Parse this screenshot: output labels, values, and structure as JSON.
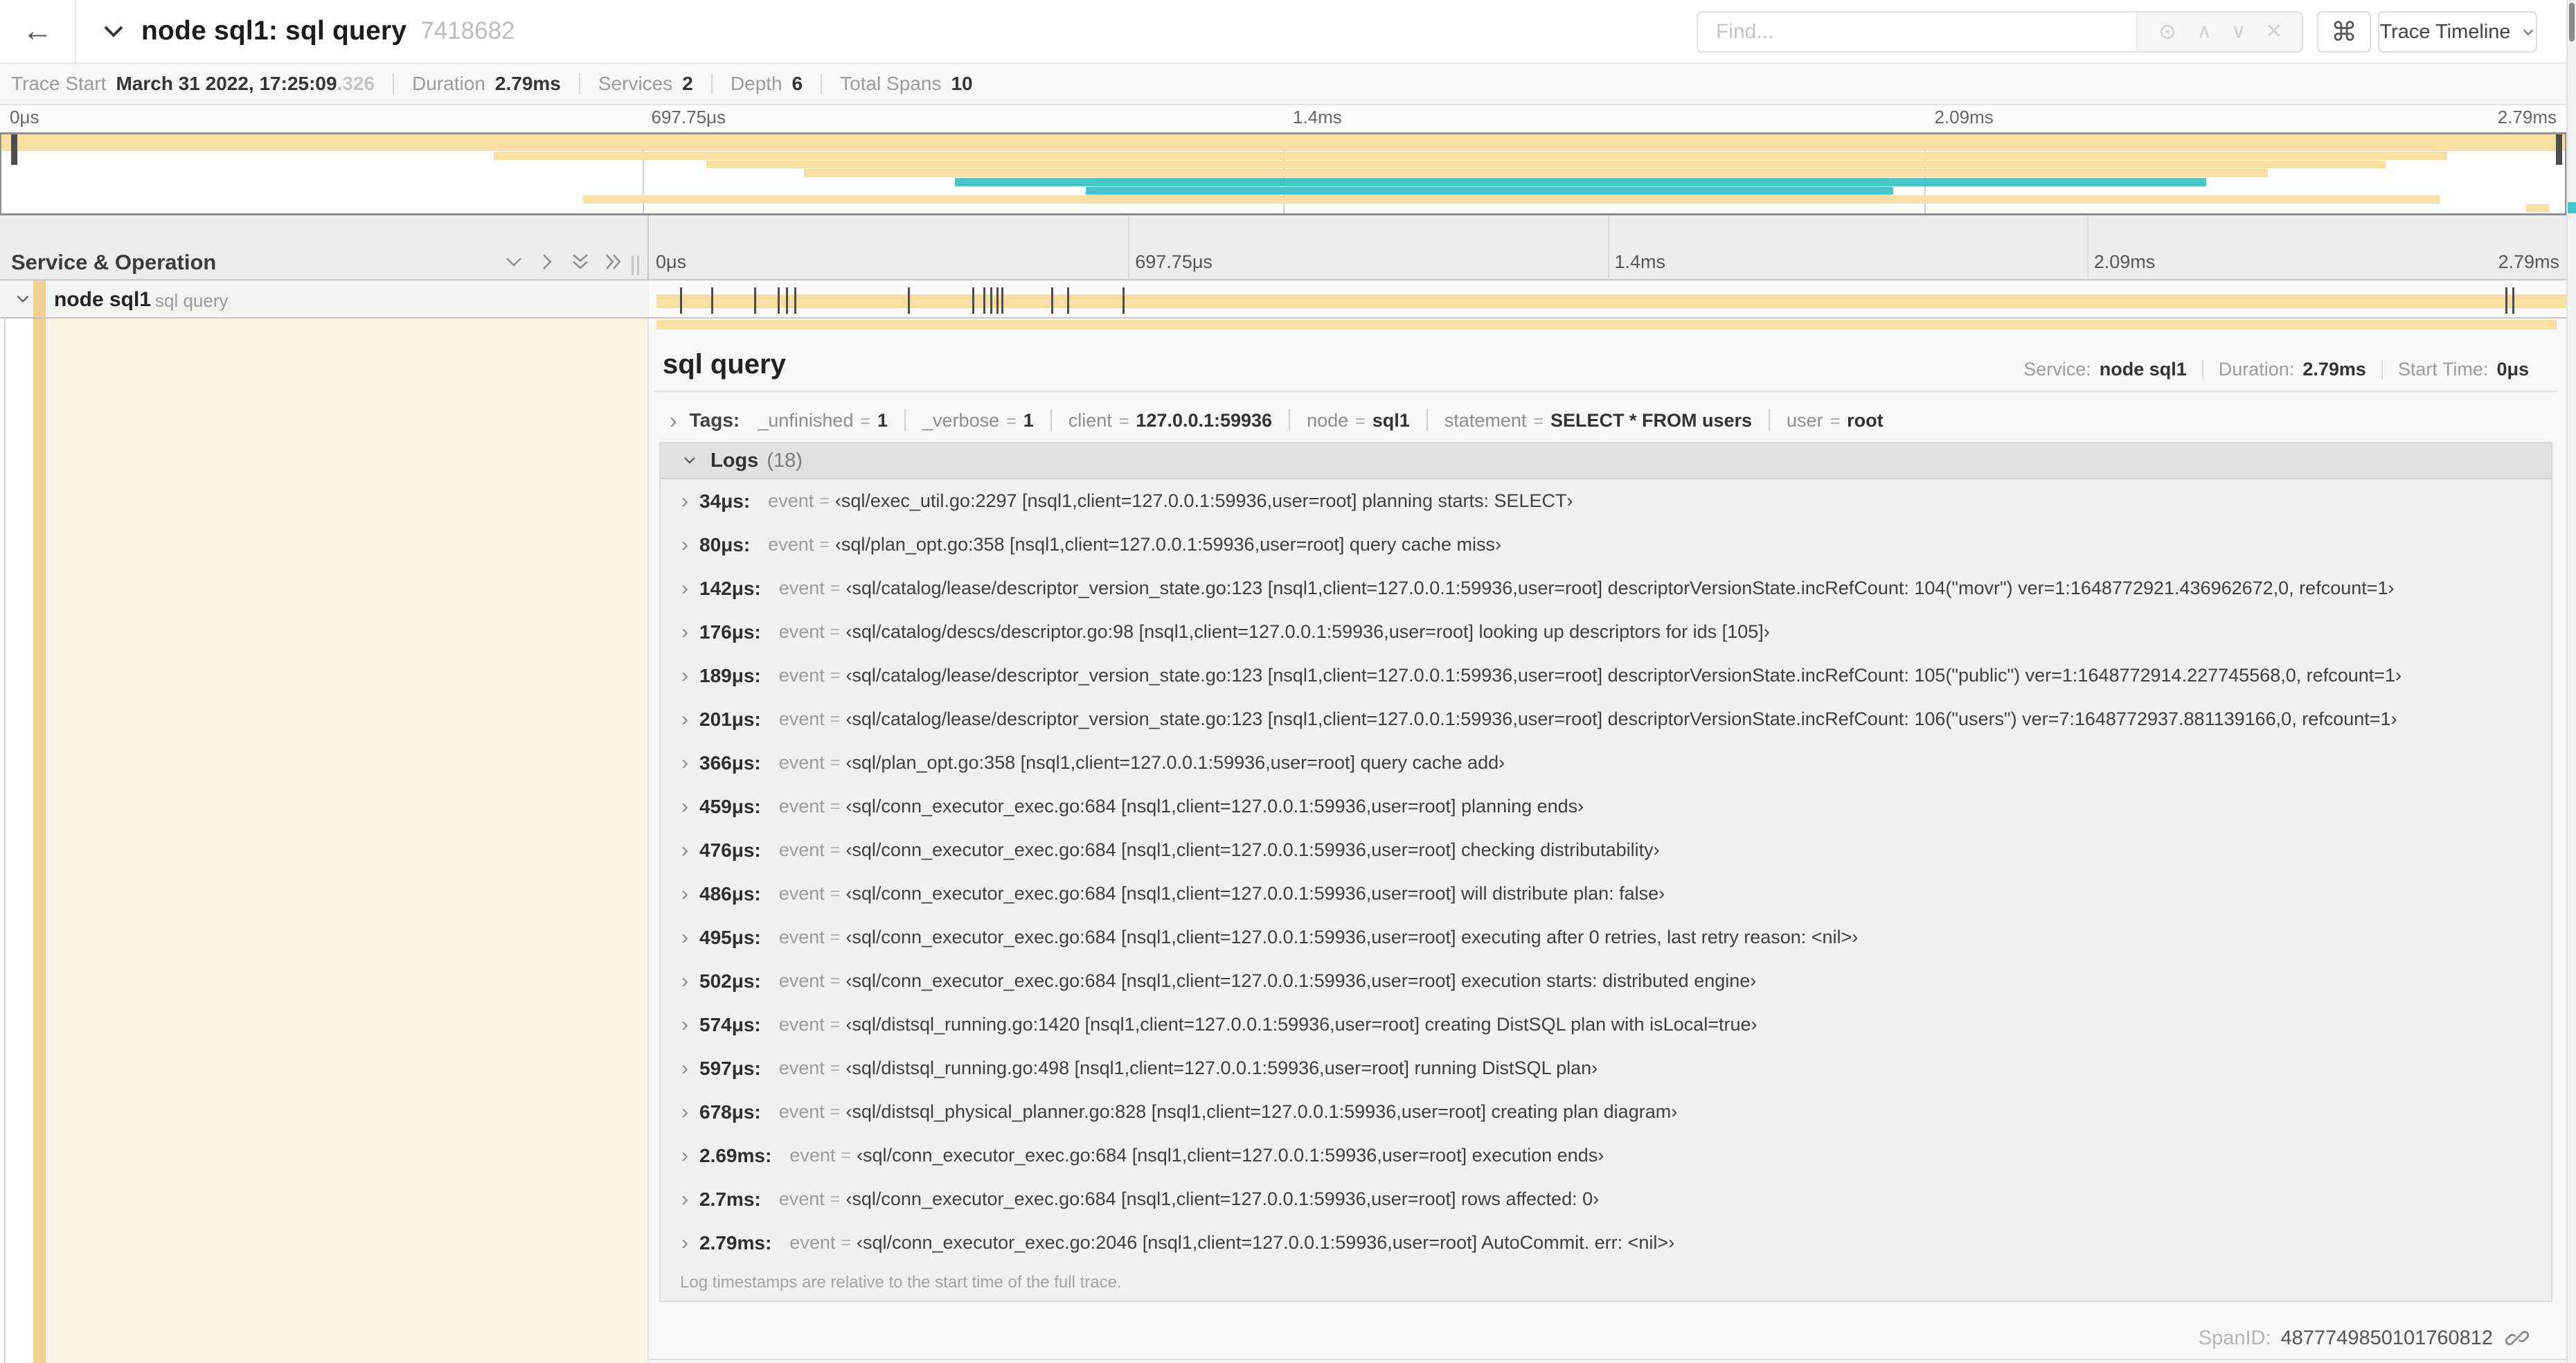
{
  "header": {
    "back_icon": "←",
    "title": "node sql1: sql query",
    "trace_id": "7418682",
    "find_placeholder": "Find...",
    "cmd_symbol": "⌘",
    "view_selector": "Trace Timeline",
    "addon_icons": [
      "crosshair-icon",
      "chevron-up-icon",
      "chevron-down-icon",
      "clear-icon"
    ]
  },
  "trace_meta": {
    "items": [
      {
        "label": "Trace Start",
        "value": "March 31 2022, 17:25:09",
        "suffix": ".326"
      },
      {
        "label": "Duration",
        "value": "2.79ms"
      },
      {
        "label": "Services",
        "value": "2"
      },
      {
        "label": "Depth",
        "value": "6"
      },
      {
        "label": "Total Spans",
        "value": "10"
      }
    ]
  },
  "timeline": {
    "axis_labels": [
      "0μs",
      "697.75μs",
      "1.4ms",
      "2.09ms",
      "2.79ms"
    ],
    "grid_pcts": [
      25,
      50,
      75
    ]
  },
  "minimap": {
    "rows": [
      {
        "left": 0,
        "width": 100,
        "color": "tan",
        "row": 0,
        "h": 2
      },
      {
        "left": 19.2,
        "width": 76.2,
        "color": "tan",
        "row": 2,
        "h": 1
      },
      {
        "left": 27.5,
        "width": 65.5,
        "color": "tan",
        "row": 3,
        "h": 1
      },
      {
        "left": 31.3,
        "width": 57.1,
        "color": "tan",
        "row": 4,
        "h": 1
      },
      {
        "left": 37.2,
        "width": 48.8,
        "color": "teal",
        "row": 5,
        "h": 1
      },
      {
        "left": 42.3,
        "width": 31.5,
        "color": "teal",
        "row": 6,
        "h": 1
      },
      {
        "left": 22.7,
        "width": 72.4,
        "color": "tan",
        "row": 7,
        "h": 1
      },
      {
        "left": 98.5,
        "width": 0.9,
        "color": "tan",
        "row": 8,
        "h": 1
      }
    ]
  },
  "span_list": {
    "header_label": "Service & Operation",
    "row": {
      "service": "node sql1",
      "operation": "sql query"
    },
    "tick_pcts": [
      1.22,
      2.87,
      5.09,
      6.31,
      6.77,
      7.2,
      13.12,
      16.45,
      17.06,
      17.42,
      17.74,
      18.0,
      20.57,
      21.4,
      24.3,
      96.42,
      96.77
    ]
  },
  "detail": {
    "title": "sql query",
    "meta": [
      {
        "label": "Service:",
        "value": "node sql1"
      },
      {
        "label": "Duration:",
        "value": "2.79ms"
      },
      {
        "label": "Start Time:",
        "value": "0μs"
      }
    ],
    "tags_label": "Tags:",
    "tags": [
      {
        "key": "_unfinished",
        "value": "1"
      },
      {
        "key": "_verbose",
        "value": "1"
      },
      {
        "key": "client",
        "value": "127.0.0.1:59936"
      },
      {
        "key": "node",
        "value": "sql1"
      },
      {
        "key": "statement",
        "value": "SELECT * FROM users"
      },
      {
        "key": "user",
        "value": "root"
      }
    ],
    "logs_label": "Logs",
    "logs_count": "(18)",
    "log_field": "event",
    "logs": [
      {
        "t": "34μs:",
        "msg": "‹sql/exec_util.go:2297 [nsql1,client=127.0.0.1:59936,user=root] planning starts: SELECT›"
      },
      {
        "t": "80μs:",
        "msg": "‹sql/plan_opt.go:358 [nsql1,client=127.0.0.1:59936,user=root] query cache miss›"
      },
      {
        "t": "142μs:",
        "msg": "‹sql/catalog/lease/descriptor_version_state.go:123 [nsql1,client=127.0.0.1:59936,user=root] descriptorVersionState.incRefCount: 104(\"movr\") ver=1:1648772921.436962672,0, refcount=1›"
      },
      {
        "t": "176μs:",
        "msg": "‹sql/catalog/descs/descriptor.go:98 [nsql1,client=127.0.0.1:59936,user=root] looking up descriptors for ids [105]›"
      },
      {
        "t": "189μs:",
        "msg": "‹sql/catalog/lease/descriptor_version_state.go:123 [nsql1,client=127.0.0.1:59936,user=root] descriptorVersionState.incRefCount: 105(\"public\") ver=1:1648772914.227745568,0, refcount=1›"
      },
      {
        "t": "201μs:",
        "msg": "‹sql/catalog/lease/descriptor_version_state.go:123 [nsql1,client=127.0.0.1:59936,user=root] descriptorVersionState.incRefCount: 106(\"users\") ver=7:1648772937.881139166,0, refcount=1›"
      },
      {
        "t": "366μs:",
        "msg": "‹sql/plan_opt.go:358 [nsql1,client=127.0.0.1:59936,user=root] query cache add›"
      },
      {
        "t": "459μs:",
        "msg": "‹sql/conn_executor_exec.go:684 [nsql1,client=127.0.0.1:59936,user=root] planning ends›"
      },
      {
        "t": "476μs:",
        "msg": "‹sql/conn_executor_exec.go:684 [nsql1,client=127.0.0.1:59936,user=root] checking distributability›"
      },
      {
        "t": "486μs:",
        "msg": "‹sql/conn_executor_exec.go:684 [nsql1,client=127.0.0.1:59936,user=root] will distribute plan: false›"
      },
      {
        "t": "495μs:",
        "msg": "‹sql/conn_executor_exec.go:684 [nsql1,client=127.0.0.1:59936,user=root] executing after 0 retries, last retry reason: <nil>›"
      },
      {
        "t": "502μs:",
        "msg": "‹sql/conn_executor_exec.go:684 [nsql1,client=127.0.0.1:59936,user=root] execution starts: distributed engine›"
      },
      {
        "t": "574μs:",
        "msg": "‹sql/distsql_running.go:1420 [nsql1,client=127.0.0.1:59936,user=root] creating DistSQL plan with isLocal=true›"
      },
      {
        "t": "597μs:",
        "msg": "‹sql/distsql_running.go:498 [nsql1,client=127.0.0.1:59936,user=root] running DistSQL plan›"
      },
      {
        "t": "678μs:",
        "msg": "‹sql/distsql_physical_planner.go:828 [nsql1,client=127.0.0.1:59936,user=root] creating plan diagram›"
      },
      {
        "t": "2.69ms:",
        "msg": "‹sql/conn_executor_exec.go:684 [nsql1,client=127.0.0.1:59936,user=root] execution ends›"
      },
      {
        "t": "2.7ms:",
        "msg": "‹sql/conn_executor_exec.go:684 [nsql1,client=127.0.0.1:59936,user=root] rows affected: 0›"
      },
      {
        "t": "2.79ms:",
        "msg": "‹sql/conn_executor_exec.go:2046 [nsql1,client=127.0.0.1:59936,user=root] AutoCommit. err: <nil>›"
      }
    ],
    "footer_note": "Log timestamps are relative to the start time of the full trace.",
    "span_id_label": "SpanID:",
    "span_id": "4877749850101760812"
  },
  "colors": {
    "tan": "#F7DFA4",
    "teal": "#43C6C8",
    "accent_strip": "#F0CF8D",
    "cream": "#FBF4E2"
  }
}
